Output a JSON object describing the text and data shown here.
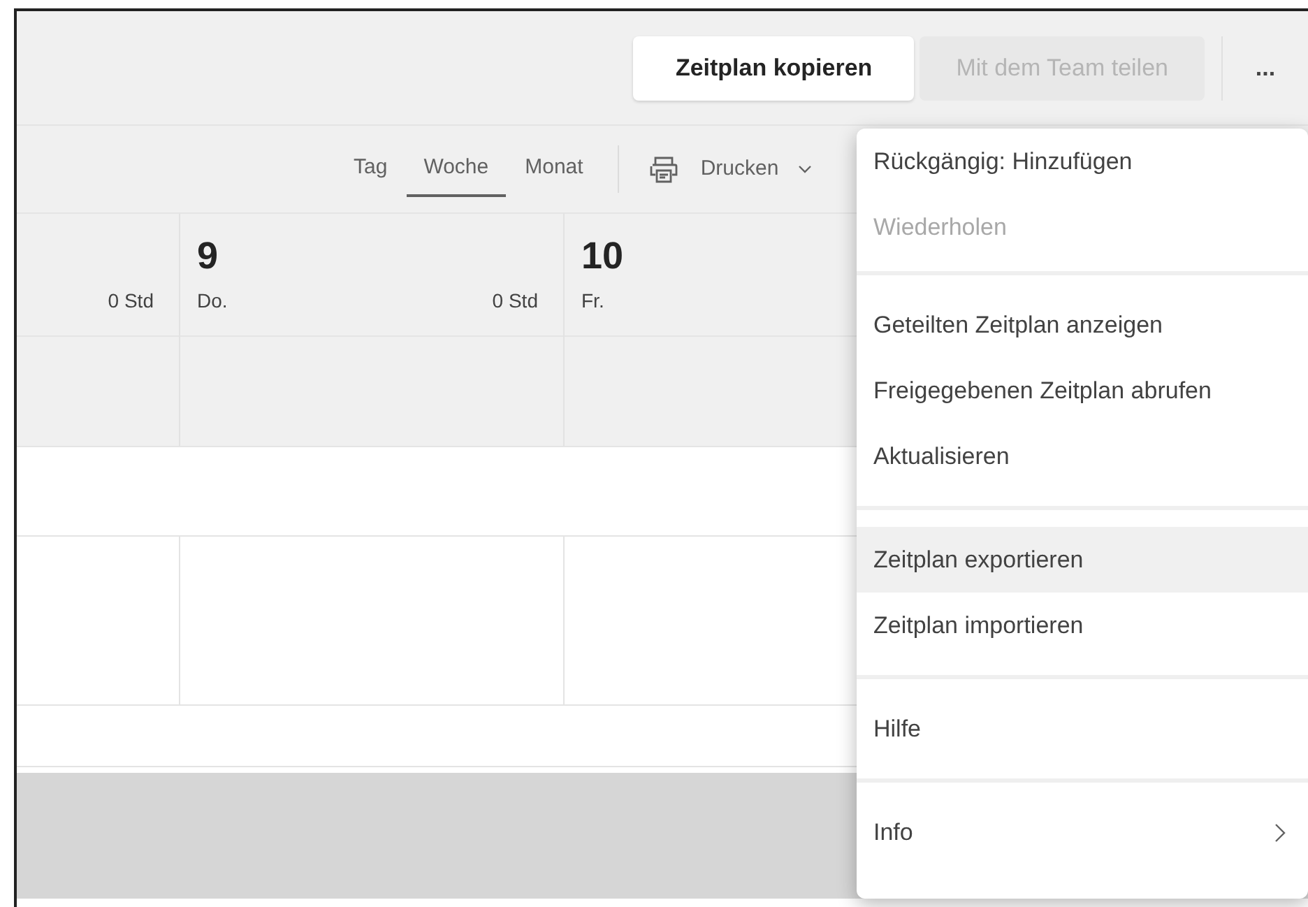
{
  "top_bar": {
    "buttons": [
      {
        "label": "Zeitplan kopieren",
        "disabled": false
      },
      {
        "label": "Mit dem Team teilen",
        "disabled": true
      }
    ],
    "more_button": "..."
  },
  "view_tabs": [
    {
      "label": "Tag",
      "selected": false
    },
    {
      "label": "Woche",
      "selected": true
    },
    {
      "label": "Monat",
      "selected": false
    }
  ],
  "print_button": {
    "label": "Drucken"
  },
  "day_columns": [
    {
      "hours": "0 Std"
    },
    {
      "date": "9",
      "weekday": "Do.",
      "hours": "0 Std"
    },
    {
      "date": "10",
      "weekday": "Fr."
    }
  ],
  "menu": {
    "groups": [
      [
        {
          "label": "Rückgängig: Hinzufügen",
          "disabled": false,
          "highlighted": false,
          "has_submenu": false
        },
        {
          "label": "Wiederholen",
          "disabled": true,
          "highlighted": false,
          "has_submenu": false
        }
      ],
      [
        {
          "label": "Geteilten Zeitplan anzeigen",
          "disabled": false,
          "highlighted": false,
          "has_submenu": false
        },
        {
          "label": "Freigegebenen Zeitplan abrufen",
          "disabled": false,
          "highlighted": false,
          "has_submenu": false
        },
        {
          "label": "Aktualisieren",
          "disabled": false,
          "highlighted": false,
          "has_submenu": false
        }
      ],
      [
        {
          "label": "Zeitplan exportieren",
          "disabled": false,
          "highlighted": true,
          "has_submenu": false
        },
        {
          "label": "Zeitplan importieren",
          "disabled": false,
          "highlighted": false,
          "has_submenu": false
        }
      ],
      [
        {
          "label": "Hilfe",
          "disabled": false,
          "highlighted": false,
          "has_submenu": false
        }
      ],
      [
        {
          "label": "Info",
          "disabled": false,
          "highlighted": false,
          "has_submenu": true
        }
      ]
    ]
  }
}
